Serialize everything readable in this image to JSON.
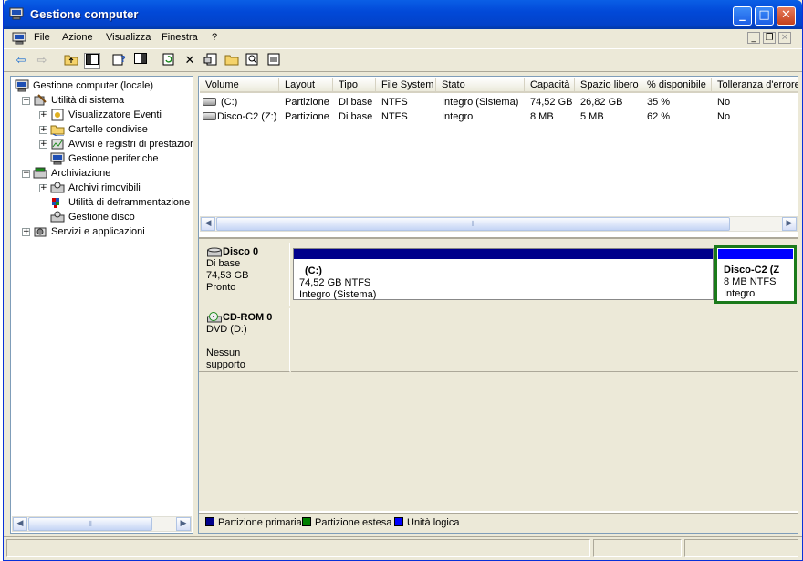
{
  "window": {
    "title": "Gestione computer",
    "icons": {
      "app": "computer-management-icon",
      "minimize": "minimize-icon",
      "maximize": "maximize-icon",
      "close": "close-icon"
    }
  },
  "menu": [
    "File",
    "Azione",
    "Visualizza",
    "Finestra",
    "?"
  ],
  "toolbar": [
    "back-arrow-icon",
    "forward-arrow-icon",
    "up-folder-icon",
    "show-hide-tree-icon",
    "help-icon",
    "properties-pane-icon",
    "refresh-icon",
    "delete-icon",
    "properties-icon",
    "open-icon",
    "search-icon",
    "help-topics-icon"
  ],
  "tree": {
    "root": "Gestione computer (locale)",
    "items": [
      "Utilità di sistema",
      "Visualizzatore Eventi",
      "Cartelle condivise",
      "Avvisi e registri di prestazioni",
      "Gestione periferiche",
      "Archiviazione",
      "Archivi rimovibili",
      "Utilità di deframmentazione dischi",
      "Gestione disco",
      "Servizi e applicazioni"
    ]
  },
  "volumes": {
    "columns": [
      "Volume",
      "Layout",
      "Tipo",
      "File System",
      "Stato",
      "Capacità",
      "Spazio libero",
      "% disponibile",
      "Tolleranza d'errore"
    ],
    "rows": [
      [
        "(C:)",
        "Partizione",
        "Di base",
        "NTFS",
        "Integro (Sistema)",
        "74,52 GB",
        "26,82 GB",
        "35 %",
        "No"
      ],
      [
        "Disco-C2 (Z:)",
        "Partizione",
        "Di base",
        "NTFS",
        "Integro",
        "8 MB",
        "5 MB",
        "62 %",
        "No"
      ]
    ]
  },
  "disks": [
    {
      "name": "Disco 0",
      "type": "Di base",
      "size": "74,53 GB",
      "status": "Pronto",
      "partitions": [
        {
          "name": "(C:)",
          "size": "74,52 GB NTFS",
          "status": "Integro (Sistema)"
        },
        {
          "name": "Disco-C2  (Z",
          "size": "8 MB NTFS",
          "status": "Integro"
        }
      ]
    },
    {
      "name": "CD-ROM 0",
      "type": "DVD (D:)",
      "status": "Nessun supporto"
    }
  ],
  "legend": [
    "Partizione primaria",
    "Partizione estesa",
    "Unità logica"
  ],
  "colors": {
    "primary": "#00008b",
    "extended": "#008000",
    "logical": "#0000ff",
    "selected": "#1a7a1a"
  }
}
